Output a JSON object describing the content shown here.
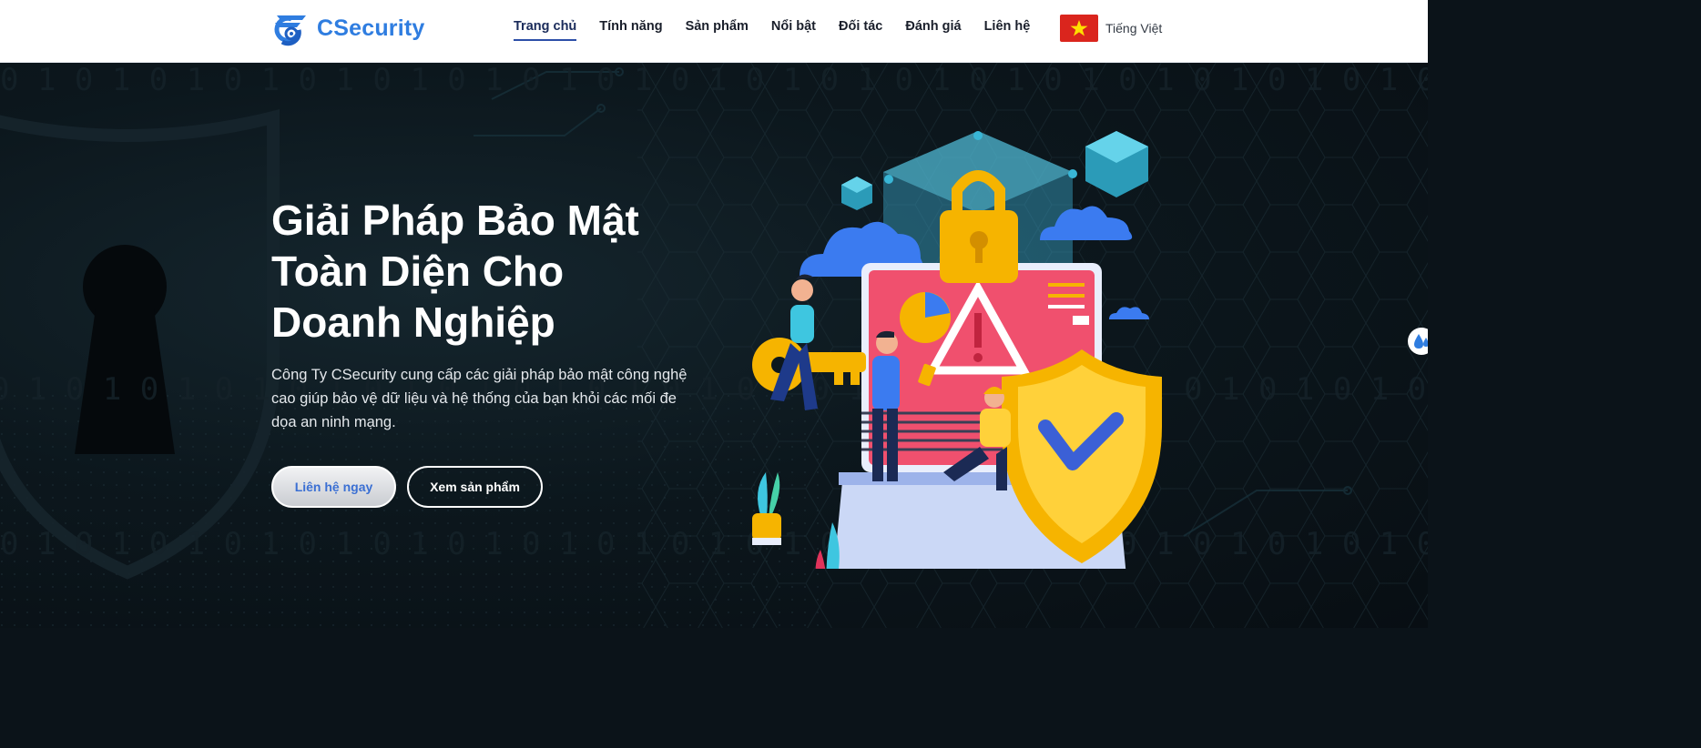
{
  "brand": {
    "name": "CSecurity",
    "logo_icon": "shield-c-logo-icon",
    "accent": "#2f7de0"
  },
  "nav": {
    "items": [
      {
        "label": "Trang chủ",
        "active": true
      },
      {
        "label": "Tính năng",
        "active": false
      },
      {
        "label": "Sản phẩm",
        "active": false
      },
      {
        "label": "Nổi bật",
        "active": false
      },
      {
        "label": "Đối tác",
        "active": false
      },
      {
        "label": "Đánh giá",
        "active": false
      },
      {
        "label": "Liên hệ",
        "active": false
      }
    ]
  },
  "language": {
    "label": "Tiếng Việt",
    "flag_icon": "vietnam-flag-icon"
  },
  "hero": {
    "title_lines": [
      "Giải Pháp Bảo Mật",
      "Toàn Diện Cho",
      "Doanh Nghiệp"
    ],
    "description": "Công Ty CSecurity cung cấp các giải pháp bảo mật công nghệ cao giúp bảo vệ dữ liệu và hệ thống của bạn khỏi các mối đe dọa an ninh mạng.",
    "primary_button": "Liên hệ ngay",
    "secondary_button": "Xem sản phẩm",
    "illustration": "cybersecurity-illustration",
    "background_digits": "0101010101010101"
  },
  "colors": {
    "hero_bg": "#0c171d",
    "shield": "#f6b400",
    "screen": "#f0506e",
    "cloud": "#3b7bf0"
  }
}
